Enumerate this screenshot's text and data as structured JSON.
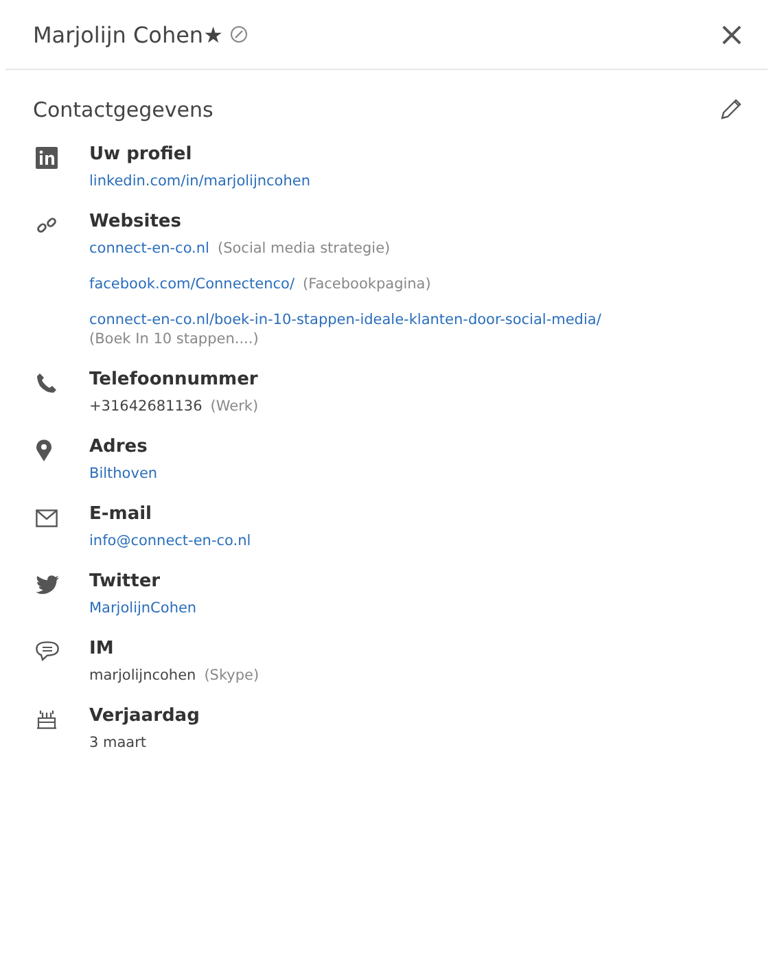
{
  "header": {
    "title": "Marjolijn Cohen★",
    "close": "×"
  },
  "section": {
    "title": "Contactgegevens"
  },
  "items": [
    {
      "kind": "linkedin",
      "label": "Uw profiel",
      "values": [
        {
          "text": "linkedin.com/in/marjolijncohen",
          "link": true
        }
      ]
    },
    {
      "kind": "websites",
      "label": "Websites",
      "values": [
        {
          "text": "connect-en-co.nl",
          "link": true,
          "note": "(Social media strategie)"
        },
        {
          "text": "facebook.com/Connectenco/",
          "link": true,
          "note": "(Facebookpagina)"
        },
        {
          "text": "connect-en-co.nl/boek-in-10-stappen-ideale-klanten-door-social-media/",
          "link": true,
          "note": "(Boek In 10 stappen....)",
          "note_below": true
        }
      ]
    },
    {
      "kind": "phone",
      "label": "Telefoonnummer",
      "values": [
        {
          "text": "+31642681136",
          "link": false,
          "note": "(Werk)"
        }
      ]
    },
    {
      "kind": "address",
      "label": "Adres",
      "values": [
        {
          "text": "Bilthoven",
          "link": true
        }
      ]
    },
    {
      "kind": "email",
      "label": "E-mail",
      "values": [
        {
          "text": "info@connect-en-co.nl",
          "link": true
        }
      ]
    },
    {
      "kind": "twitter",
      "label": "Twitter",
      "values": [
        {
          "text": "MarjolijnCohen",
          "link": true
        }
      ]
    },
    {
      "kind": "im",
      "label": "IM",
      "values": [
        {
          "text": "marjolijncohen",
          "link": false,
          "note": "(Skype)"
        }
      ]
    },
    {
      "kind": "birthday",
      "label": "Verjaardag",
      "values": [
        {
          "text": "3 maart",
          "link": false
        }
      ]
    }
  ]
}
